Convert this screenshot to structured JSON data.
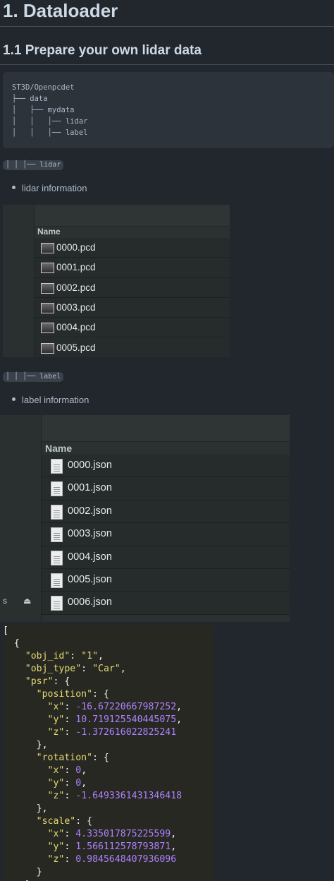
{
  "headings": {
    "h1": "1. Dataloader",
    "h2": "1.1 Prepare your own lidar data"
  },
  "tree": {
    "lines": [
      "ST3D/Openpcdet",
      "├── data",
      "│   ├── mydata",
      "│   │   │── lidar",
      "│   │   │── label"
    ]
  },
  "lidar_section": {
    "chip": "│ │ │── lidar",
    "bullet": "lidar information",
    "column_header": "Name",
    "files": [
      "0000.pcd",
      "0001.pcd",
      "0002.pcd",
      "0003.pcd",
      "0004.pcd",
      "0005.pcd"
    ]
  },
  "label_section": {
    "chip": "│ │ │── label",
    "bullet": "label information",
    "column_header": "Name",
    "files": [
      "0000.json",
      "0001.json",
      "0002.json",
      "0003.json",
      "0004.json",
      "0005.json",
      "0006.json"
    ],
    "sidebar_fragments": [
      "s",
      "⏏"
    ]
  },
  "json_example": {
    "lines": [
      "[",
      "  {",
      "    \"obj_id\": \"1\",",
      "    \"obj_type\": \"Car\",",
      "    \"psr\": {",
      "      \"position\": {",
      "        \"x\": -16.67220667987252,",
      "        \"y\": 10.719125540445075,",
      "        \"z\": -1.372616022825241",
      "      },",
      "      \"rotation\": {",
      "        \"x\": 0,",
      "        \"y\": 0,",
      "        \"z\": -1.6493361431346418",
      "      },",
      "      \"scale\": {",
      "        \"x\": 4.335017875225599,",
      "        \"y\": 1.566112578793871,",
      "        \"z\": 0.9845648407936096",
      "      }",
      "    }"
    ]
  },
  "colors": {
    "background": "#22272e",
    "code_bg": "#2d333b",
    "json_key": "#e6db74",
    "json_number": "#ae81ff"
  }
}
